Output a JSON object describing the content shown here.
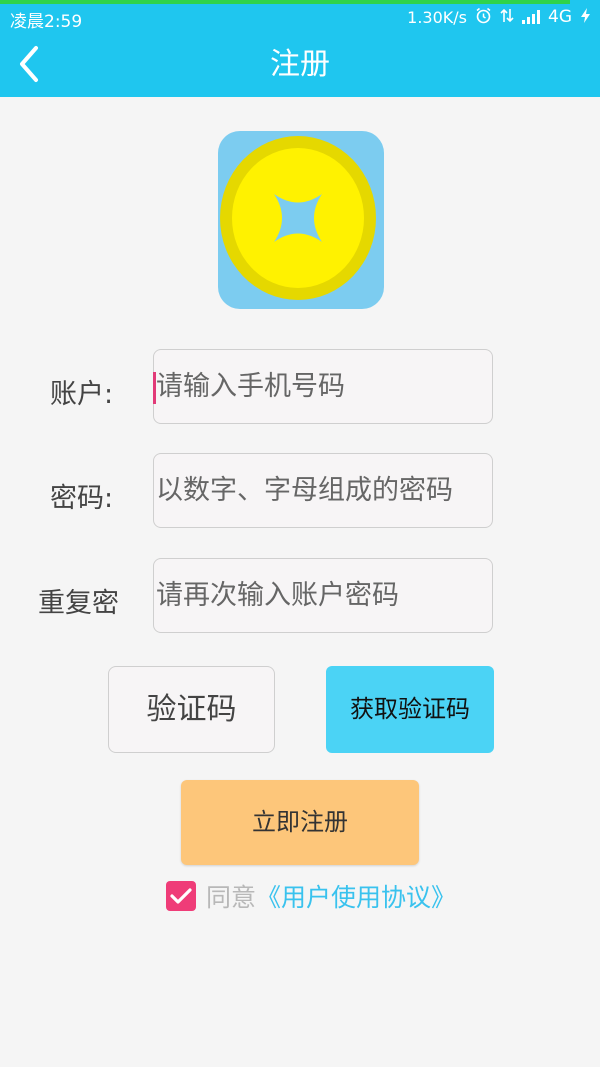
{
  "status_bar": {
    "time": "凌晨2:59",
    "network_speed": "1.30K/s",
    "network_type": "4G",
    "icons": [
      "alarm-icon",
      "data-transfer-icon",
      "signal-icon",
      "charging-icon"
    ]
  },
  "header": {
    "title": "注册",
    "back_icon": "chevron-left-icon"
  },
  "logo": {
    "icon": "coin-icon",
    "colors": {
      "background": "#7cccf0",
      "coin_outer": "#e5d800",
      "coin_inner": "#fff200"
    }
  },
  "form": {
    "account": {
      "label": "账户:",
      "placeholder": "请输入手机号码",
      "value": ""
    },
    "password": {
      "label": "密码:",
      "placeholder": "以数字、字母组成的密码",
      "value": ""
    },
    "confirm": {
      "label": "重复密",
      "placeholder": "请再次输入账户密码",
      "value": ""
    },
    "code": {
      "placeholder": "验证码"
    },
    "get_code_label": "获取验证码",
    "register_label": "立即注册"
  },
  "agreement": {
    "checked": true,
    "prefix": "同意",
    "link": "《用户使用协议》"
  },
  "colors": {
    "primary": "#1fc6ef",
    "button_blue": "#4bd3f5",
    "button_orange": "#fdc67a",
    "checkbox_pink": "#ef3c78",
    "link": "#39c2ee"
  }
}
